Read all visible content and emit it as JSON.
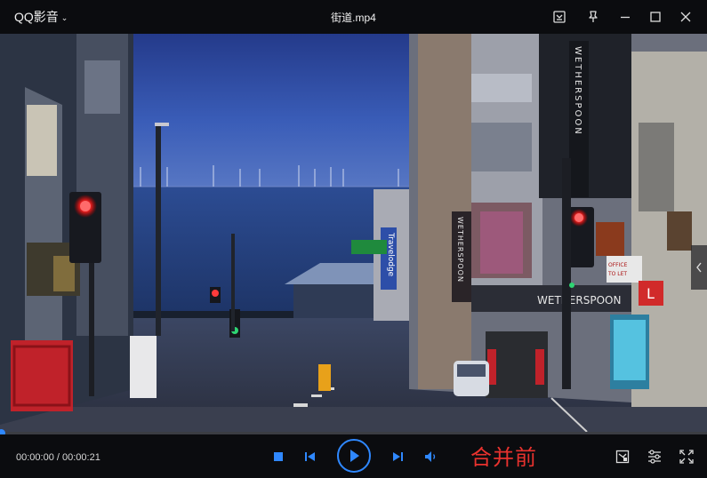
{
  "app": {
    "menu_label": "QQ影音"
  },
  "window": {
    "file_title": "街道.mp4"
  },
  "video": {
    "signs": {
      "hotel_vertical": "Travelodge",
      "pub_vertical_1": "WETHERSPOON",
      "pub_vertical_2": "WETHERSPOON",
      "pub_fascia": "WETHERSPOON",
      "shop_office": "OFFICE",
      "shop_to_let": "TO LET",
      "right_shop_letter": "L"
    }
  },
  "player": {
    "current_time": "00:00:00",
    "separator": " / ",
    "total_time": "00:00:21",
    "progress_fraction": 0.0,
    "overlay_caption": "合并前"
  },
  "colors": {
    "accent": "#2f88ff",
    "caption": "#e8322e",
    "background": "#0b0c0f"
  }
}
